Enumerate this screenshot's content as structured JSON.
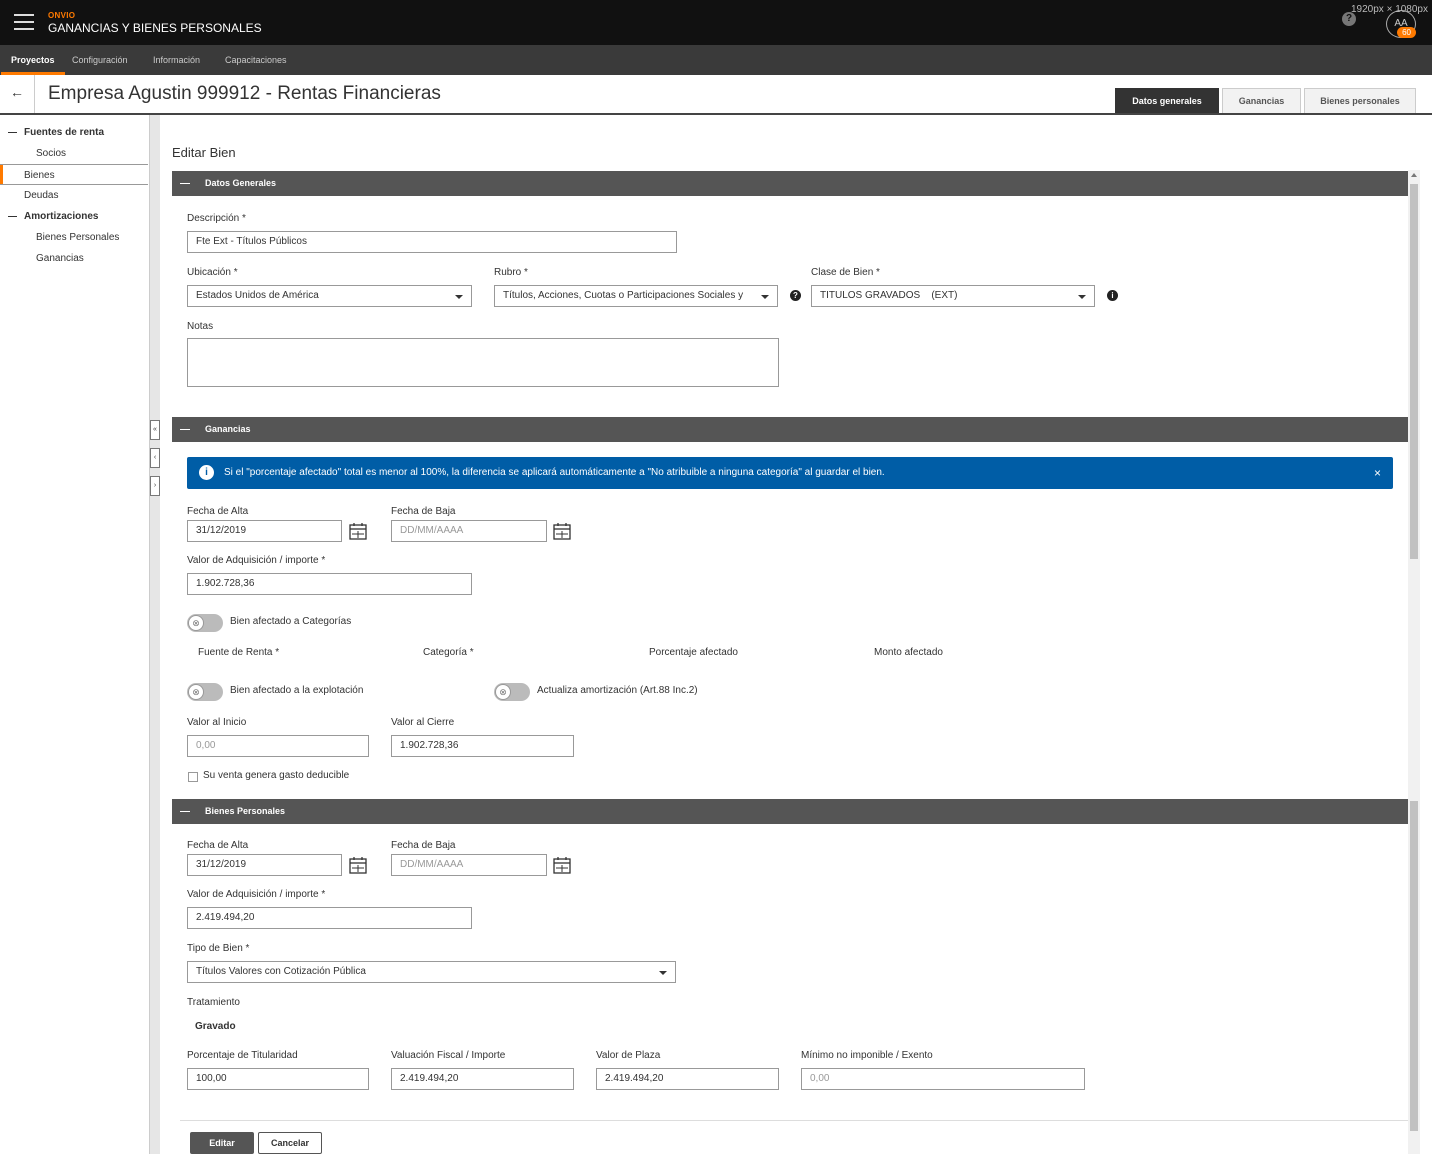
{
  "app": {
    "brand_small": "ONVIO",
    "brand_title": "GANANCIAS Y BIENES PERSONALES",
    "resolution": "1920px × 1080px",
    "avatar_initials": "AA",
    "avatar_count": "60",
    "help_glyph": "?"
  },
  "nav": [
    "Proyectos",
    "Configuración",
    "Información",
    "Capacitaciones"
  ],
  "page": {
    "title": "Empresa Agustin 999912 - Rentas Financieras",
    "back_glyph": "←"
  },
  "tabs": [
    "Datos generales",
    "Ganancias",
    "Bienes personales"
  ],
  "sidebar": [
    {
      "label": "Fuentes de renta"
    },
    {
      "label": "Socios"
    },
    {
      "label": "Bienes"
    },
    {
      "label": "Deudas"
    },
    {
      "label": "Amortizaciones"
    },
    {
      "label": "Bienes Personales"
    },
    {
      "label": "Ganancias"
    }
  ],
  "collapse_glyphs": [
    "«",
    "‹",
    "›"
  ],
  "form": {
    "title": "Editar Bien",
    "datos_generales": {
      "header": "Datos Generales",
      "descripcion_label": "Descripción *",
      "descripcion_value": "Fte Ext - Títulos Públicos",
      "ubicacion_label": "Ubicación *",
      "ubicacion_value": "Estados Unidos de América",
      "rubro_label": "Rubro *",
      "rubro_value": "Títulos, Acciones, Cuotas o Participaciones Sociales y",
      "clase_label": "Clase de Bien *",
      "clase_value": "TITULOS GRAVADOS    (EXT)",
      "notas_label": "Notas",
      "info_glyph": "?",
      "info_glyph2": "i"
    },
    "ganancias": {
      "header": "Ganancias",
      "alert_glyph": "i",
      "alert_text": "Si el \"porcentaje afectado\" total es menor al 100%, la diferencia se aplicará automáticamente a \"No atribuible a ninguna categoría\" al guardar el bien.",
      "alert_close": "×",
      "fecha_alta_label": "Fecha de Alta",
      "fecha_alta_value": "31/12/2019",
      "fecha_baja_label": "Fecha de Baja",
      "fecha_baja_placeholder": "DD/MM/AAAA",
      "valor_adq_label": "Valor de Adquisición / importe *",
      "valor_adq_value": "1.902.728,36",
      "toggle_categorias_label": "Bien afectado a Categorías",
      "col_fuente": "Fuente de Renta *",
      "col_categoria": "Categoría *",
      "col_porcentaje": "Porcentaje afectado",
      "col_monto": "Monto afectado",
      "toggle_explotacion_label": "Bien afectado a la explotación",
      "toggle_amortizacion_label": "Actualiza amortización (Art.88 Inc.2)",
      "valor_inicio_label": "Valor al Inicio",
      "valor_inicio_placeholder": "0,00",
      "valor_cierre_label": "Valor al Cierre",
      "valor_cierre_value": "1.902.728,36",
      "checkbox_label": "Su venta genera gasto deducible",
      "toggle_glyph": "⊗"
    },
    "bienes_personales": {
      "header": "Bienes Personales",
      "fecha_alta_label": "Fecha de Alta",
      "fecha_alta_value": "31/12/2019",
      "fecha_baja_label": "Fecha de Baja",
      "fecha_baja_placeholder": "DD/MM/AAAA",
      "valor_adq_label": "Valor de Adquisición / importe *",
      "valor_adq_value": "2.419.494,20",
      "tipo_label": "Tipo de Bien *",
      "tipo_value": "Títulos Valores con Cotización Pública",
      "tratamiento_label": "Tratamiento",
      "tratamiento_value": "Gravado",
      "porcentaje_label": "Porcentaje de Titularidad",
      "porcentaje_value": "100,00",
      "valuacion_label": "Valuación Fiscal / Importe",
      "valuacion_value": "2.419.494,20",
      "plaza_label": "Valor de Plaza",
      "plaza_value": "2.419.494,20",
      "minimo_label": "Mínimo no imponible / Exento",
      "minimo_placeholder": "0,00"
    },
    "buttons": {
      "editar": "Editar",
      "cancelar": "Cancelar"
    }
  }
}
